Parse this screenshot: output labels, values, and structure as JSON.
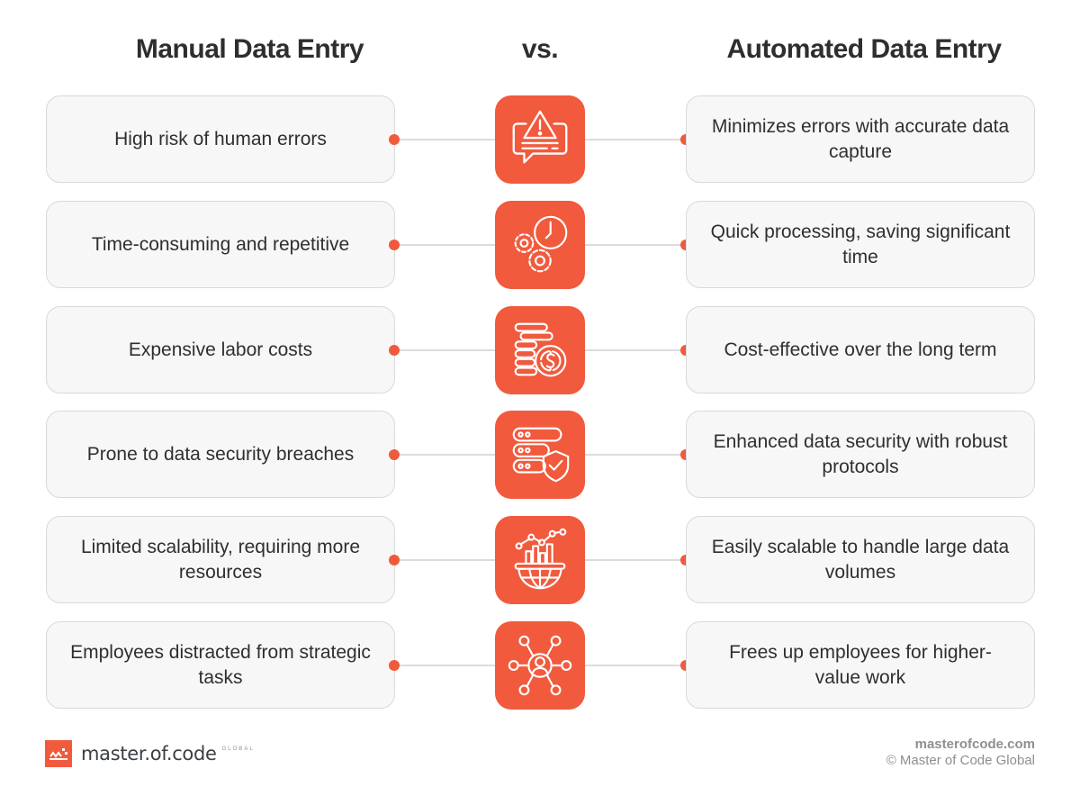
{
  "headings": {
    "left": "Manual Data Entry",
    "vs": "vs.",
    "right": "Automated Data Entry"
  },
  "accent_color": "#F15A3D",
  "rows": [
    {
      "manual": "High risk of human errors",
      "automated": "Minimizes errors with accurate data capture",
      "icon": "alert-message-icon"
    },
    {
      "manual": "Time-consuming and repetitive",
      "automated": "Quick processing, saving significant time",
      "icon": "gears-clock-icon"
    },
    {
      "manual": "Expensive labor costs",
      "automated": "Cost-effective over the long term",
      "icon": "coins-dollar-icon"
    },
    {
      "manual": "Prone to data security breaches",
      "automated": "Enhanced data security with robust protocols",
      "icon": "server-shield-icon"
    },
    {
      "manual": "Limited scalability, requiring more resources",
      "automated": "Easily scalable to handle large data volumes",
      "icon": "global-growth-chart-icon"
    },
    {
      "manual": "Employees distracted from strategic tasks",
      "automated": "Frees up employees for higher-value work",
      "icon": "user-network-icon"
    }
  ],
  "footer": {
    "logo_text": "master.of.code",
    "logo_sub": "GLOBAL",
    "site": "masterofcode.com",
    "copyright": "© Master of Code Global"
  }
}
